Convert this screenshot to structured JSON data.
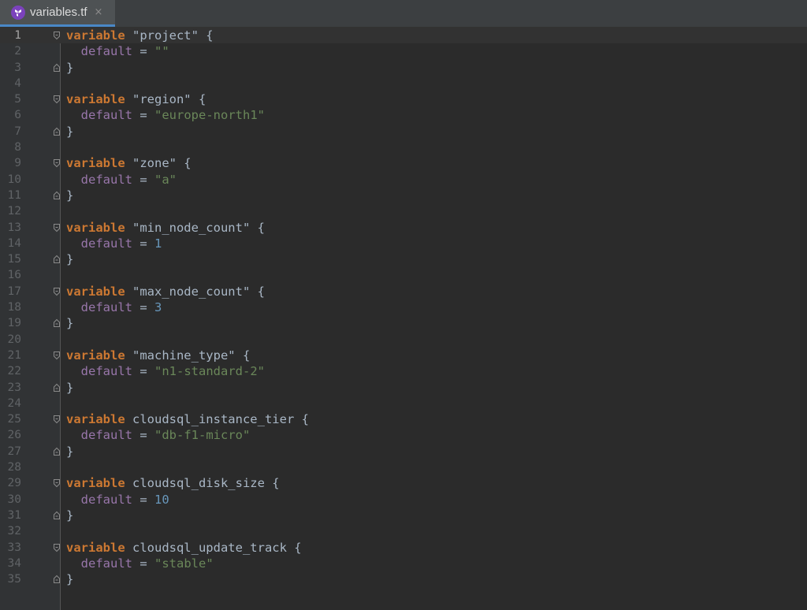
{
  "tab": {
    "title": "variables.tf",
    "close": "×",
    "icon": "terraform-icon",
    "accent": "#7b42bc"
  },
  "colors": {
    "keyword": "#cc7832",
    "property": "#9876aa",
    "string": "#6a8759",
    "number": "#6897bb",
    "text": "#a9b7c6",
    "background": "#2b2b2b"
  },
  "lines": [
    {
      "n": "1",
      "t": [
        [
          "kw",
          "variable"
        ],
        [
          "p",
          " \"project\" {"
        ]
      ],
      "fold": "open"
    },
    {
      "n": "2",
      "t": [
        [
          "p",
          "  "
        ],
        [
          "prop",
          "default"
        ],
        [
          "p",
          " = "
        ],
        [
          "str",
          "\"\""
        ]
      ]
    },
    {
      "n": "3",
      "t": [
        [
          "p",
          "}"
        ]
      ],
      "fold": "close"
    },
    {
      "n": "4",
      "t": []
    },
    {
      "n": "5",
      "t": [
        [
          "kw",
          "variable"
        ],
        [
          "p",
          " \"region\" {"
        ]
      ],
      "fold": "open"
    },
    {
      "n": "6",
      "t": [
        [
          "p",
          "  "
        ],
        [
          "prop",
          "default"
        ],
        [
          "p",
          " = "
        ],
        [
          "str",
          "\"europe-north1\""
        ]
      ]
    },
    {
      "n": "7",
      "t": [
        [
          "p",
          "}"
        ]
      ],
      "fold": "close"
    },
    {
      "n": "8",
      "t": []
    },
    {
      "n": "9",
      "t": [
        [
          "kw",
          "variable"
        ],
        [
          "p",
          " \"zone\" {"
        ]
      ],
      "fold": "open"
    },
    {
      "n": "10",
      "t": [
        [
          "p",
          "  "
        ],
        [
          "prop",
          "default"
        ],
        [
          "p",
          " = "
        ],
        [
          "str",
          "\"a\""
        ]
      ]
    },
    {
      "n": "11",
      "t": [
        [
          "p",
          "}"
        ]
      ],
      "fold": "close"
    },
    {
      "n": "12",
      "t": []
    },
    {
      "n": "13",
      "t": [
        [
          "kw",
          "variable"
        ],
        [
          "p",
          " \"min_node_count\" {"
        ]
      ],
      "fold": "open"
    },
    {
      "n": "14",
      "t": [
        [
          "p",
          "  "
        ],
        [
          "prop",
          "default"
        ],
        [
          "p",
          " = "
        ],
        [
          "num",
          "1"
        ]
      ]
    },
    {
      "n": "15",
      "t": [
        [
          "p",
          "}"
        ]
      ],
      "fold": "close"
    },
    {
      "n": "16",
      "t": []
    },
    {
      "n": "17",
      "t": [
        [
          "kw",
          "variable"
        ],
        [
          "p",
          " \"max_node_count\" {"
        ]
      ],
      "fold": "open"
    },
    {
      "n": "18",
      "t": [
        [
          "p",
          "  "
        ],
        [
          "prop",
          "default"
        ],
        [
          "p",
          " = "
        ],
        [
          "num",
          "3"
        ]
      ]
    },
    {
      "n": "19",
      "t": [
        [
          "p",
          "}"
        ]
      ],
      "fold": "close"
    },
    {
      "n": "20",
      "t": []
    },
    {
      "n": "21",
      "t": [
        [
          "kw",
          "variable"
        ],
        [
          "p",
          " \"machine_type\" {"
        ]
      ],
      "fold": "open"
    },
    {
      "n": "22",
      "t": [
        [
          "p",
          "  "
        ],
        [
          "prop",
          "default"
        ],
        [
          "p",
          " = "
        ],
        [
          "str",
          "\"n1-standard-2\""
        ]
      ]
    },
    {
      "n": "23",
      "t": [
        [
          "p",
          "}"
        ]
      ],
      "fold": "close"
    },
    {
      "n": "24",
      "t": []
    },
    {
      "n": "25",
      "t": [
        [
          "kw",
          "variable"
        ],
        [
          "p",
          " cloudsql_instance_tier {"
        ]
      ],
      "fold": "open"
    },
    {
      "n": "26",
      "t": [
        [
          "p",
          "  "
        ],
        [
          "prop",
          "default"
        ],
        [
          "p",
          " = "
        ],
        [
          "str",
          "\"db-f1-micro\""
        ]
      ]
    },
    {
      "n": "27",
      "t": [
        [
          "p",
          "}"
        ]
      ],
      "fold": "close"
    },
    {
      "n": "28",
      "t": []
    },
    {
      "n": "29",
      "t": [
        [
          "kw",
          "variable"
        ],
        [
          "p",
          " cloudsql_disk_size {"
        ]
      ],
      "fold": "open"
    },
    {
      "n": "30",
      "t": [
        [
          "p",
          "  "
        ],
        [
          "prop",
          "default"
        ],
        [
          "p",
          " = "
        ],
        [
          "num",
          "10"
        ]
      ]
    },
    {
      "n": "31",
      "t": [
        [
          "p",
          "}"
        ]
      ],
      "fold": "close"
    },
    {
      "n": "32",
      "t": []
    },
    {
      "n": "33",
      "t": [
        [
          "kw",
          "variable"
        ],
        [
          "p",
          " cloudsql_update_track {"
        ]
      ],
      "fold": "open"
    },
    {
      "n": "34",
      "t": [
        [
          "p",
          "  "
        ],
        [
          "prop",
          "default"
        ],
        [
          "p",
          " = "
        ],
        [
          "str",
          "\"stable\""
        ]
      ]
    },
    {
      "n": "35",
      "t": [
        [
          "p",
          "}"
        ]
      ],
      "fold": "close"
    }
  ]
}
